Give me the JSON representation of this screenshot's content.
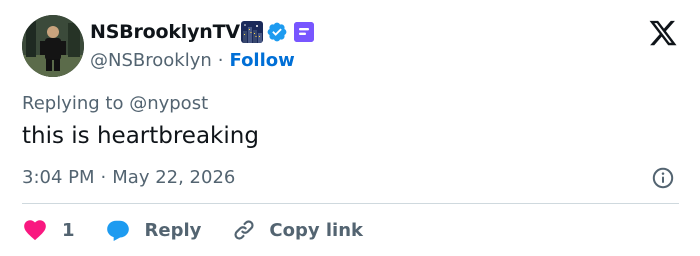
{
  "author": {
    "display_name": "NSBrooklynTV",
    "handle": "@NSBrooklyn",
    "separator": "·",
    "follow_label": "Follow"
  },
  "tweet": {
    "replying_to": "Replying to @nypost",
    "text": "this is heartbreaking",
    "time": "3:04 PM",
    "separator": "·",
    "date": "May 22, 2026"
  },
  "actions": {
    "like_count": "1",
    "reply_label": "Reply",
    "copy_label": "Copy link"
  },
  "icons": {
    "brand": "x-logo-icon",
    "verified": "verified-badge-icon",
    "affiliate": "affiliate-badge-icon",
    "info": "info-icon",
    "like": "heart-icon",
    "reply": "reply-bubble-icon",
    "copy": "link-icon"
  },
  "colors": {
    "text": "#0f1419",
    "secondary": "#536471",
    "link": "#006fd6",
    "verified": "#1d9bf0",
    "affiliate": "#7856ff",
    "like": "#f91880",
    "reply": "#1d9bf0",
    "divider": "#cfd9de"
  }
}
